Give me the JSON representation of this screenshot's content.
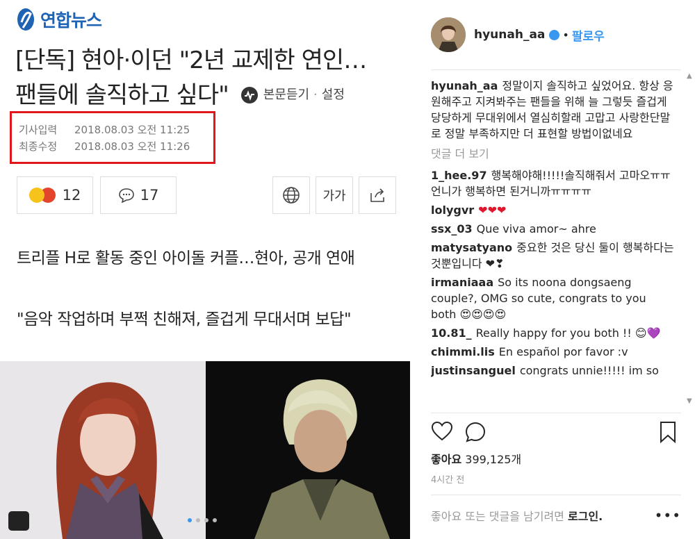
{
  "news": {
    "logo_text": "연합뉴스",
    "headline_line1": "[단독] 현아·이던 \"2년 교제한 연인…",
    "headline_line2": "팬들에 솔직하고 싶다\"",
    "listen_label": "본문듣기",
    "settings_label": "설정",
    "dates": [
      {
        "label": "기사입력",
        "value": "2018.08.03 오전 11:25"
      },
      {
        "label": "최종수정",
        "value": "2018.08.03 오전 11:26"
      }
    ],
    "reaction_count": "12",
    "comment_count": "17",
    "font_size_label": "가가",
    "subtitle1": "트리플 H로 활동 중인 아이돌 커플…현아, 공개 연애",
    "subtitle2": "\"음악 작업하며 부쩍 친해져, 즐겁게 무대서며 보답\""
  },
  "instagram": {
    "username": "hyunah_aa",
    "follow_label": "팔로우",
    "caption_user": "hyunah_aa",
    "caption": "정말이지 솔직하고 싶었어요. 항상 응원해주고 지켜봐주는 팬들을 위해 늘 그렇듯 즐겁게 당당하게 무대위에서 열심히할래 고맙고 사랑한단말로 정말 부족하지만 더 표현할 방법이없네요",
    "more_comments": "댓글 더 보기",
    "comments": [
      {
        "user": "1_hee.97",
        "text": "행복해야해!!!!!솔직해줘서 고마오ㅠㅠ언니가 행복하면 된거니까ㅠㅠㅠㅠ"
      },
      {
        "user": "lolygvr",
        "text": "❤❤❤"
      },
      {
        "user": "ssx_03",
        "text": "Que viva amor~ ahre"
      },
      {
        "user": "matysatyano",
        "text": "중요한 것은 당신 둘이 행복하다는 것뿐입니다 ❤❣"
      },
      {
        "user": "irmaniaaa",
        "text": "So its noona dongsaeng couple?, OMG so cute, congrats to you both 😍😍😍😍"
      },
      {
        "user": "10.81_",
        "text": "Really happy for you both !! 😊💜"
      },
      {
        "user": "chimmi.lis",
        "text": "En español por favor :v"
      },
      {
        "user": "justinsanguel",
        "text": "congrats unnie!!!!! im so"
      }
    ],
    "likes_label": "좋아요",
    "likes_count": "399,125개",
    "time": "4시간 전",
    "login_prompt": "좋아요 또는 댓글을 남기려면",
    "login_label": "로그인."
  }
}
